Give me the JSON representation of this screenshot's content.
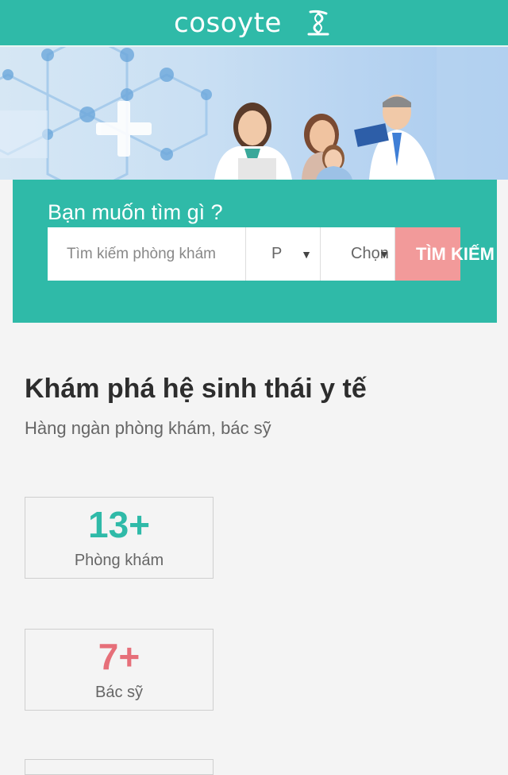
{
  "colors": {
    "accent": "#2fbaa8",
    "pink": "#e66f79",
    "button": "#f29a9a"
  },
  "header": {
    "logo_text": "cosoyte",
    "logo_icon": "caduceus-icon"
  },
  "search": {
    "title": "Bạn muốn tìm gì ?",
    "placeholder": "Tìm kiếm phòng khám",
    "select_1": "P",
    "select_2": "Chọn",
    "button_label": "TÌM KIẾM"
  },
  "explore": {
    "title": "Khám phá hệ sinh thái y tế",
    "subtitle": "Hàng ngàn phòng khám, bác sỹ"
  },
  "stats": [
    {
      "value": "13+",
      "label": "Phòng khám",
      "color": "#2fbaa8"
    },
    {
      "value": "7+",
      "label": "Bác sỹ",
      "color": "#e66f79"
    }
  ]
}
